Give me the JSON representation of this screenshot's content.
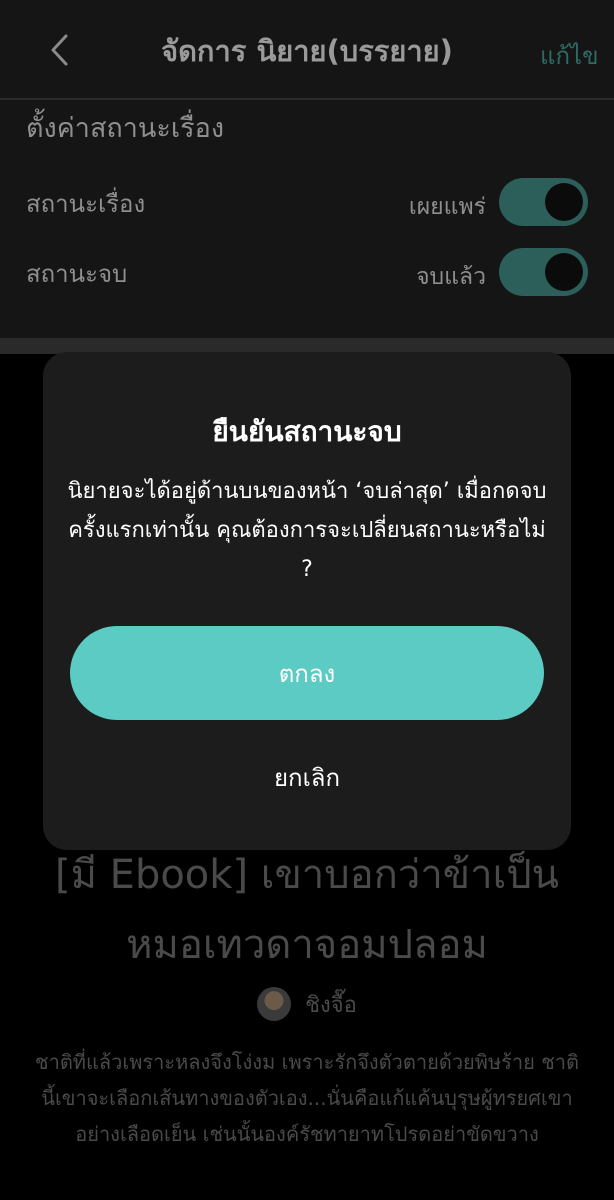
{
  "header": {
    "title": "จัดการ นิยาย(บรรยาย)",
    "edit_label": "แก้ไข"
  },
  "settings": {
    "section_title": "ตั้งค่าสถานะเรื่อง",
    "rows": [
      {
        "label": "สถานะเรื่อง",
        "value": "เผยแพร่",
        "toggle_on": true
      },
      {
        "label": "สถานะจบ",
        "value": "จบแล้ว",
        "toggle_on": true
      }
    ]
  },
  "novel": {
    "title": "[มี Ebook] เขาบอกว่าข้าเป็นหมอเทวดาจอมปลอม",
    "author": "ชิงจื๊อ",
    "synopsis": "ชาติที่แล้วเพราะหลงจึงโง่งม เพราะรักจึงตัวตายด้วยพิษร้าย ชาตินี้เขาจะเลือกเส้นทางของตัวเอง...นั่นคือแก้แค้นบุรุษผู้ทรยศเขาอย่างเลือดเย็น เช่นนั้นองค์รัชทายาทโปรดอย่าขัดขวาง"
  },
  "dialog": {
    "title": "ยืนยันสถานะจบ",
    "message": "นิยายจะได้อยู่ด้านบนของหน้า ‘จบล่าสุด’ เมื่อกดจบครั้งแรกเท่านั้น คุณต้องการจะเปลี่ยนสถานะหรือไม่ ?",
    "confirm_label": "ตกลง",
    "cancel_label": "ยกเลิก"
  },
  "colors": {
    "accent": "#5ccbc3",
    "toggle_track": "#2c5e5a",
    "dialog_bg": "#1c1c1c"
  },
  "icons": {
    "back": "chevron-left-icon",
    "avatar": "author-avatar"
  }
}
